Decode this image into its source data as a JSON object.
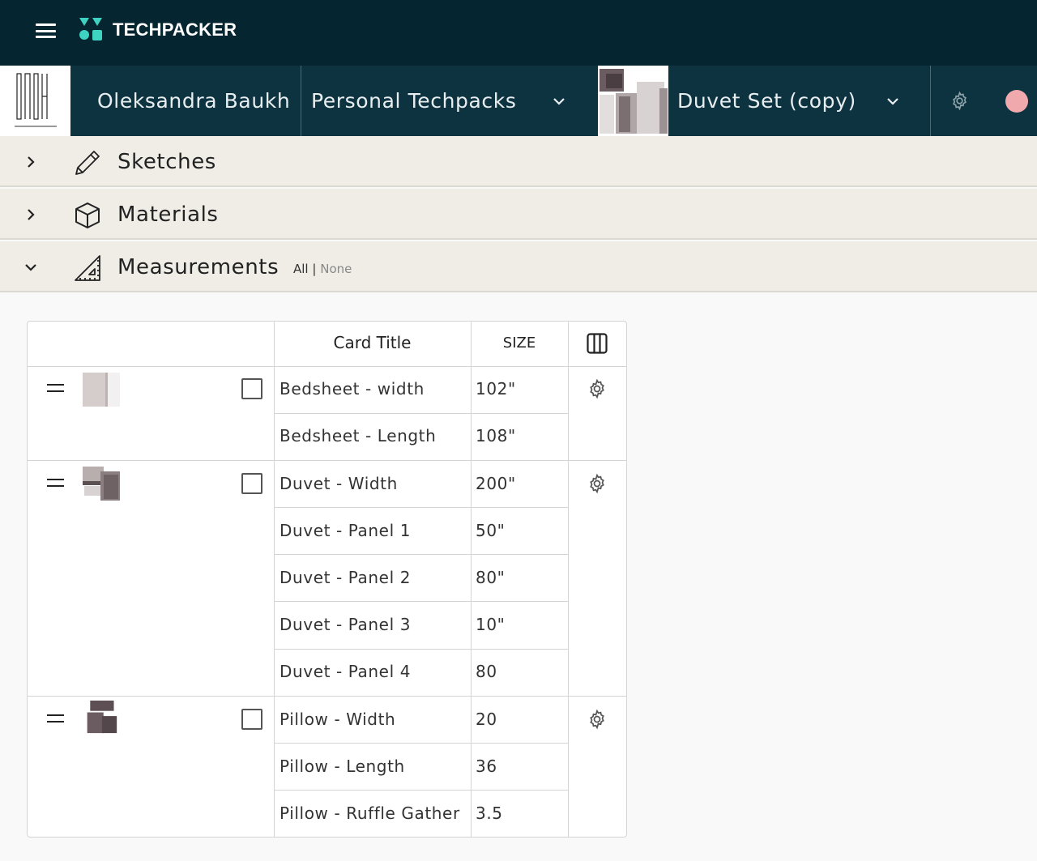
{
  "topbar": {
    "menu_icon": "hamburger-icon",
    "logo_icon": "techpacker-logo-icon",
    "brand": "TECHPACKER"
  },
  "context_bar": {
    "brand_thumbnail": "BAUH",
    "owner": "Oleksandra Baukh",
    "workspace": "Personal Techpacks",
    "product": "Duvet Set (copy)",
    "avatar_color": "#f0a9ad"
  },
  "sections": [
    {
      "title": "Sketches",
      "icon": "pencil-icon",
      "expanded": false
    },
    {
      "title": "Materials",
      "icon": "cube-icon",
      "expanded": false
    },
    {
      "title": "Measurements",
      "icon": "ruler-triangle-icon",
      "expanded": true
    }
  ],
  "measurements_links": {
    "all": "All",
    "divider": "|",
    "none": "None"
  },
  "table": {
    "columns": [
      "Card Title",
      "SIZE"
    ],
    "groups": [
      {
        "rows": [
          {
            "title": "Bedsheet - width",
            "size": "102\""
          },
          {
            "title": "Bedsheet - Length",
            "size": "108\""
          }
        ]
      },
      {
        "rows": [
          {
            "title": "Duvet - Width",
            "size": "200\""
          },
          {
            "title": "Duvet - Panel 1",
            "size": "50\""
          },
          {
            "title": "Duvet - Panel 2",
            "size": "80\""
          },
          {
            "title": "Duvet - Panel 3",
            "size": "10\""
          },
          {
            "title": "Duvet - Panel 4",
            "size": "80"
          }
        ]
      },
      {
        "rows": [
          {
            "title": "Pillow - Width",
            "size": "20"
          },
          {
            "title": "Pillow - Length",
            "size": "36"
          },
          {
            "title": "Pillow - Ruffle Gather",
            "size": "3.5"
          }
        ]
      }
    ]
  },
  "colors": {
    "topbar": "#052530",
    "context_bar": "#0e3340",
    "section_bg": "#f0ede7",
    "logo_teal": "#3ed3c0"
  }
}
